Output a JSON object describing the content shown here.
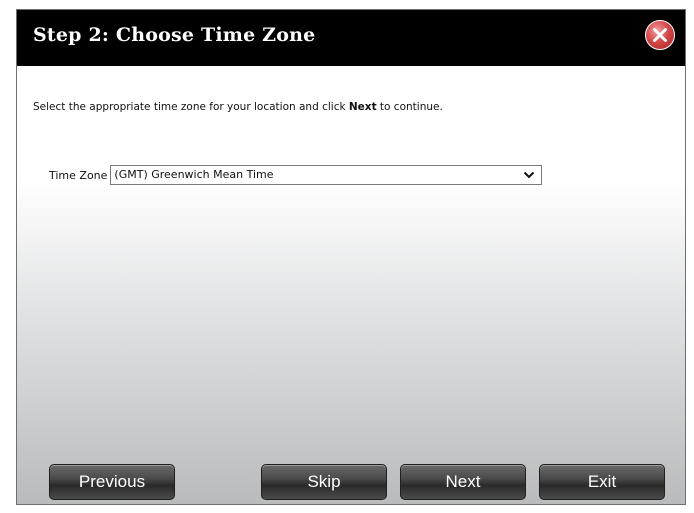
{
  "dialog": {
    "title": "Step 2: Choose Time Zone",
    "close_icon": "close-icon"
  },
  "instruction": {
    "before": "Select the appropriate time zone for your location and click ",
    "bold": "Next",
    "after": " to continue."
  },
  "timezone": {
    "label": "Time Zone",
    "selected": "(GMT) Greenwich Mean Time"
  },
  "buttons": {
    "previous": "Previous",
    "skip": "Skip",
    "next": "Next",
    "exit": "Exit"
  },
  "colors": {
    "titlebar": "#000000",
    "close": "#d64848"
  }
}
